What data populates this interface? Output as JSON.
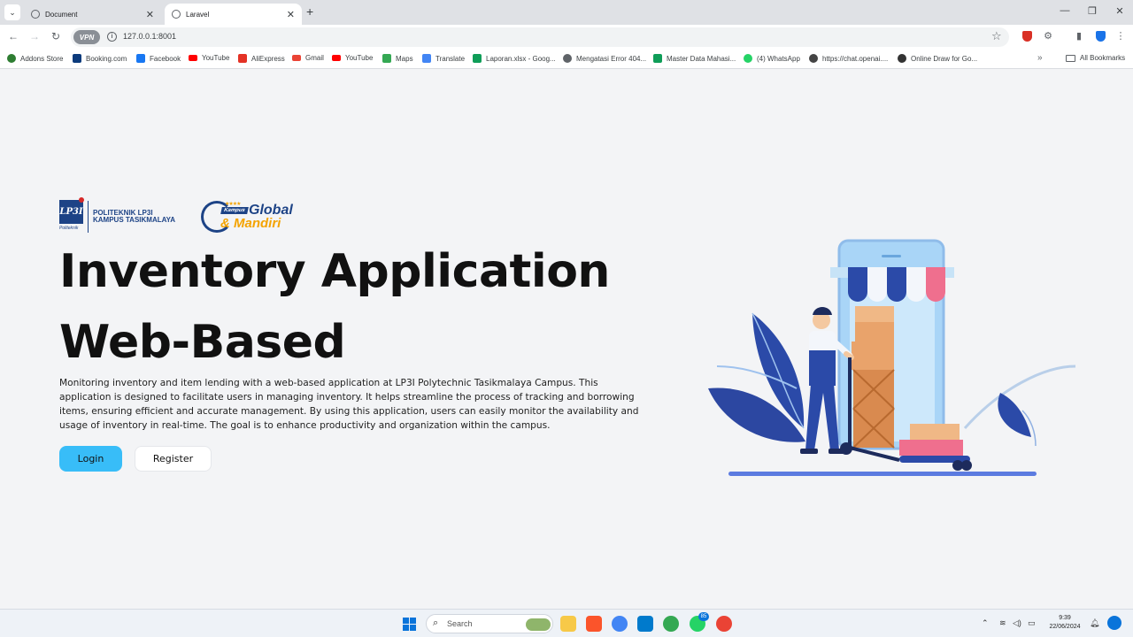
{
  "browser": {
    "tabs": [
      {
        "title": "Document",
        "active": false
      },
      {
        "title": "Laravel",
        "active": true
      }
    ],
    "url": "127.0.0.1:8001",
    "vpn_label": "VPN",
    "bookmarks": [
      {
        "label": "Addons Store",
        "color": "#2e7d32"
      },
      {
        "label": "Booking.com",
        "color": "#0c3b7c"
      },
      {
        "label": "Facebook",
        "color": "#1877f2"
      },
      {
        "label": "YouTube",
        "color": "#ff0000"
      },
      {
        "label": "AliExpress",
        "color": "#e43225"
      },
      {
        "label": "Gmail",
        "color": "#ea4335"
      },
      {
        "label": "YouTube",
        "color": "#ff0000"
      },
      {
        "label": "Maps",
        "color": "#34a853"
      },
      {
        "label": "Translate",
        "color": "#4285f4"
      },
      {
        "label": "Laporan.xlsx - Goog...",
        "color": "#0f9d58"
      },
      {
        "label": "Mengatasi Error 404...",
        "color": "#5f6368"
      },
      {
        "label": "Master Data Mahasi...",
        "color": "#0f9d58"
      },
      {
        "label": "(4) WhatsApp",
        "color": "#25d366"
      },
      {
        "label": "https://chat.openai....",
        "color": "#444444"
      },
      {
        "label": "Online Draw for Go...",
        "color": "#333333"
      }
    ],
    "all_bookmarks": "All Bookmarks"
  },
  "logos": {
    "lp3i_mark": "LP3I",
    "lp3i_sub": "Politeknik",
    "lp3i_line1": "POLITEKNIK LP3I",
    "lp3i_line2": "KAMPUS TASIKMALAYA",
    "kgm_kampus": "Kampus",
    "kgm_global": "Global",
    "kgm_mandiri": "& Mandiri",
    "kgm_stars": "★★★★"
  },
  "hero": {
    "title_line1": "Inventory Application",
    "title_line2": "Web-Based",
    "description": "Monitoring inventory and item lending with a web-based application at LP3I Polytechnic Tasikmalaya Campus. This application is designed to facilitate users in managing inventory. It helps streamline the process of tracking and borrowing items, ensuring efficient and accurate management. By using this application, users can easily monitor the availability and usage of inventory in real-time. The goal is to enhance productivity and organization within the campus.",
    "login_label": "Login",
    "register_label": "Register"
  },
  "colors": {
    "login_bg": "#38bdf8",
    "brand_navy": "#1d4386",
    "brand_orange": "#f4a300"
  },
  "taskbar": {
    "search_placeholder": "Search",
    "whatsapp_badge": "85",
    "time": "9:39",
    "date": "22/06/2024"
  }
}
